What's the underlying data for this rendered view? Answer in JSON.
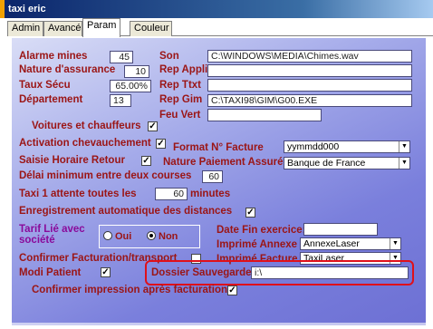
{
  "window": {
    "title": "taxi eric"
  },
  "tabs": [
    {
      "label": "Admin"
    },
    {
      "label": "Avancé"
    },
    {
      "label": "Param"
    },
    {
      "label": "Couleur"
    }
  ],
  "left": {
    "alarme_label": "Alarme mines",
    "alarme_value": "45",
    "nature_label": "Nature d'assurance",
    "nature_value": "10",
    "taux_label": "Taux Sécu",
    "taux_value": "65.00%",
    "departement_label": "Département",
    "departement_value": "13",
    "voitures_label": "Voitures et chauffeurs"
  },
  "right": {
    "son_label": "Son",
    "son_value": "C:\\WINDOWS\\MEDIA\\Chimes.wav",
    "rep_appli_label": "Rep Appli",
    "rep_appli_value": "",
    "rep_ttxt_label": "Rep Ttxt",
    "rep_ttxt_value": "",
    "rep_gim_label": "Rep Gim",
    "rep_gim_value": "C:\\TAXI98\\GIM\\G00.EXE",
    "feu_vert_label": "Feu Vert",
    "feu_vert_value": ""
  },
  "rows": {
    "activation_label": "Activation chevauchement",
    "format_label": "Format N° Facture",
    "format_value": "yymmdd000",
    "saisie_label": "Saisie Horaire Retour",
    "nature_paiement_label": "Nature Paiement Assuré",
    "nature_paiement_value": "Banque de France",
    "delai_label": "Délai minimum entre deux courses",
    "delai_value": "60",
    "taxi_attente_label": "Taxi 1 attente toutes les",
    "taxi_attente_value": "60",
    "taxi_attente_unit": "minutes",
    "enregistrement_label": "Enregistrement automatique des distances",
    "tarif_label": "Tarif Lié avec société",
    "oui_label": "Oui",
    "non_label": "Non",
    "date_fin_label": "Date Fin exercice:",
    "date_fin_value": "",
    "imprime_annexe_label": "Imprimé Annexe",
    "imprime_annexe_value": "AnnexeLaser",
    "confirmer_fact_label": "Confirmer Facturation/transport",
    "imprime_facture_label": "Imprimé Facture",
    "imprime_facture_value": "TaxiLaser",
    "modi_patient_label": "Modi Patient",
    "dossier_label": "Dossier Sauvegarde",
    "dossier_value": "i:\\",
    "confirmer_impression_label": "Confirmer impression après facturation"
  },
  "checks": {
    "checked_mark": "✓",
    "unchecked_mark": ""
  },
  "colors": {
    "label_red": "#9b1515",
    "highlight_red": "#e0101a"
  }
}
